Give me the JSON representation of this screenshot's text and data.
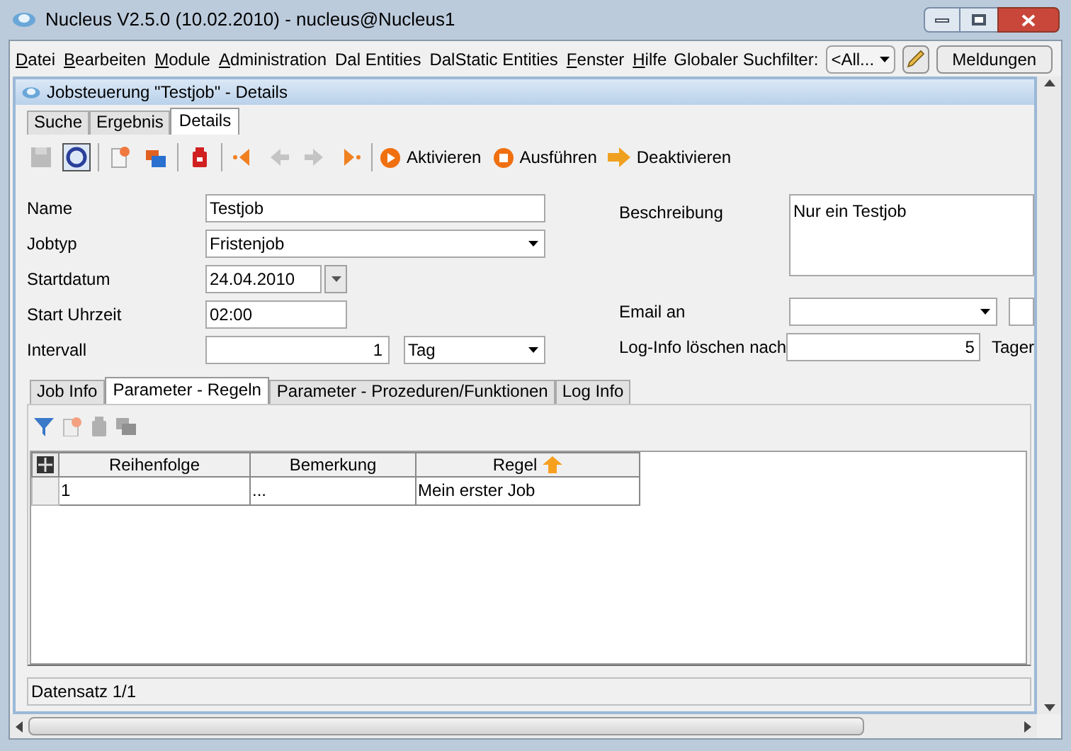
{
  "window": {
    "title": "Nucleus V2.5.0 (10.02.2010) - nucleus@Nucleus1"
  },
  "menu": [
    {
      "label": "Datei",
      "mnemonic": true
    },
    {
      "label": "Bearbeiten",
      "mnemonic": true
    },
    {
      "label": "Module",
      "mnemonic": true
    },
    {
      "label": "Administration",
      "mnemonic": true
    },
    {
      "label": "Dal Entities",
      "mnemonic": false
    },
    {
      "label": "DalStatic Entities",
      "mnemonic": false
    },
    {
      "label": "Fenster",
      "mnemonic": true
    },
    {
      "label": "Hilfe",
      "mnemonic": true
    }
  ],
  "search_filter": {
    "label": "Globaler Suchfilter:",
    "value": "<All..."
  },
  "messages_button": "Meldungen",
  "document": {
    "title": "Jobsteuerung \"Testjob\" - Details",
    "tabs": [
      {
        "label": "Suche",
        "selected": false
      },
      {
        "label": "Ergebnis",
        "selected": false
      },
      {
        "label": "Details",
        "selected": true
      }
    ],
    "toolbar": {
      "icon_buttons": [
        {
          "disabled": true
        },
        {
          "disabled": false
        },
        {
          "disabled": false
        },
        {
          "disabled": false
        },
        {
          "disabled": false
        },
        {
          "disabled": false
        },
        {
          "disabled": true
        },
        {
          "disabled": true
        },
        {
          "disabled": false
        }
      ],
      "buttons": [
        {
          "label": "Aktivieren"
        },
        {
          "label": "Ausführen"
        },
        {
          "label": "Deaktivieren"
        }
      ]
    },
    "form_left": [
      {
        "kind": "text",
        "label": "Name",
        "value": "Testjob"
      },
      {
        "kind": "dropdown",
        "label": "Jobtyp",
        "value": "Fristenjob"
      },
      {
        "kind": "date",
        "label": "Startdatum",
        "value": "24.04.2010"
      },
      {
        "kind": "time",
        "label": "Start Uhrzeit",
        "value": "02:00"
      },
      {
        "kind": "interval",
        "label": "Intervall",
        "value": "1",
        "unit": "Tag"
      }
    ],
    "description": {
      "label": "Beschreibung",
      "value": "Nur ein Testjob"
    },
    "email": {
      "label": "Email an"
    },
    "log_delete": {
      "label": "Log-Info löschen nach",
      "value": "5",
      "unit": "Tager"
    },
    "subtabs": [
      {
        "label": "Job Info",
        "selected": false
      },
      {
        "label": "Parameter - Regeln",
        "selected": true
      },
      {
        "label": "Parameter - Prozeduren/Funktionen",
        "selected": false
      },
      {
        "label": "Log Info",
        "selected": false
      }
    ],
    "table": {
      "columns": [
        {
          "label": "Reihenfolge",
          "sorted": false
        },
        {
          "label": "Bemerkung",
          "sorted": false
        },
        {
          "label": "Regel",
          "sorted": true
        }
      ],
      "rows": [
        [
          "1",
          "...",
          "Mein erster Job"
        ]
      ]
    },
    "status_bar": "Datensatz 1/1"
  }
}
